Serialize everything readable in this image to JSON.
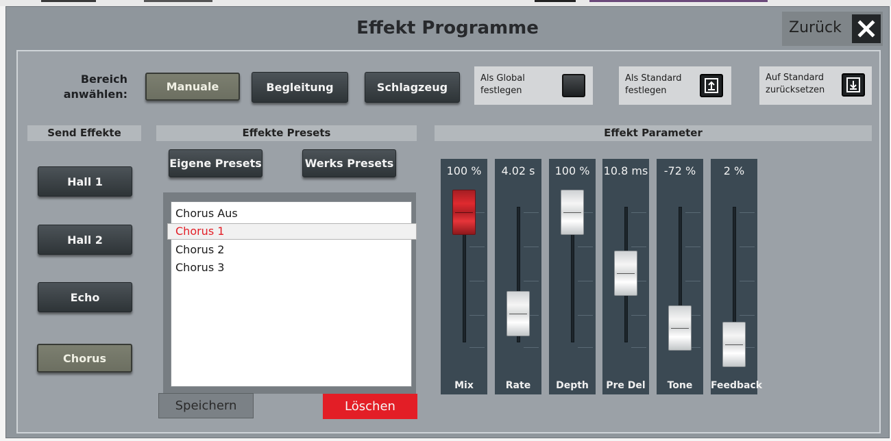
{
  "dialog": {
    "title": "Effekt Programme",
    "back_label": "Zurück",
    "close_icon": "close-icon"
  },
  "area": {
    "label": "Bereich anwählen:",
    "label_line1": "Bereich",
    "label_line2": "anwählen:",
    "buttons": [
      {
        "label": "Manuale",
        "active": true
      },
      {
        "label": "Begleitung",
        "active": false
      },
      {
        "label": "Schlagzeug",
        "active": false
      }
    ]
  },
  "options": [
    {
      "line1": "Als Global",
      "line2": "festlegen",
      "icon": "toggle-square-icon"
    },
    {
      "line1": "Als Standard",
      "line2": "festlegen",
      "icon": "save-upload-icon"
    },
    {
      "line1": "Auf Standard",
      "line2": "zurücksetzen",
      "icon": "restore-download-icon"
    }
  ],
  "send_effects": {
    "header": "Send Effekte",
    "buttons": [
      {
        "label": "Hall 1",
        "active": false
      },
      {
        "label": "Hall 2",
        "active": false
      },
      {
        "label": "Echo",
        "active": false
      },
      {
        "label": "Chorus",
        "active": true
      }
    ]
  },
  "presets": {
    "header": "Effekte Presets",
    "own_label": "Eigene Presets",
    "factory_label": "Werks Presets",
    "items": [
      "Chorus Aus",
      "Chorus 1",
      "Chorus 2",
      "Chorus 3"
    ],
    "selected_index": 1,
    "save_label": "Speichern",
    "delete_label": "Löschen"
  },
  "parameters": {
    "header": "Effekt Parameter",
    "faders": [
      {
        "name": "Mix",
        "value": "100 %",
        "level": 1.0,
        "active": true
      },
      {
        "name": "Rate",
        "value": "4.02 s",
        "level": 0.25,
        "active": false
      },
      {
        "name": "Depth",
        "value": "100 %",
        "level": 1.0,
        "active": false
      },
      {
        "name": "Pre Del",
        "value": "10.8 ms",
        "level": 0.55,
        "active": false
      },
      {
        "name": "Tone",
        "value": "-72 %",
        "level": 0.14,
        "active": false
      },
      {
        "name": "Feedback",
        "value": "2 %",
        "level": 0.02,
        "active": false
      }
    ]
  },
  "colors": {
    "accent_red": "#e31e26",
    "selected_text": "#e31e26",
    "fader_bg": "#3b4953"
  }
}
